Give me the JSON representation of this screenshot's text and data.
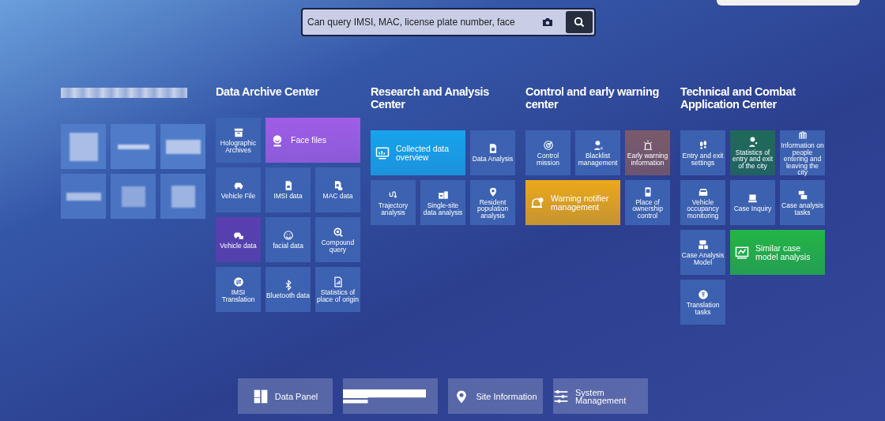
{
  "search": {
    "placeholder": "Can query IMSI, MAC, license plate number, face"
  },
  "sections": [
    {
      "title": "Data Archive Center",
      "tiles": [
        {
          "label": "Holographic Archives",
          "wide": false
        },
        {
          "label": "Face files",
          "wide": true,
          "color": "#a05de6"
        },
        {
          "label": "Vehicle File",
          "wide": false
        },
        {
          "label": "IMSI data",
          "wide": false
        },
        {
          "label": "MAC data",
          "wide": false
        },
        {
          "label": "Vehicle data",
          "wide": false,
          "color": "#5a3fb0"
        },
        {
          "label": "facial data",
          "wide": false
        },
        {
          "label": "Compound query",
          "wide": false
        },
        {
          "label": "IMSI Translation",
          "wide": false
        },
        {
          "label": "Bluetooth data",
          "wide": false
        },
        {
          "label": "Statistics of place of origin",
          "wide": false
        }
      ]
    },
    {
      "title": "Research and Analysis Center",
      "tiles": [
        {
          "label": "Collected data overview",
          "wide": true,
          "color": "#17a3ec"
        },
        {
          "label": "Data Analysis",
          "wide": false
        },
        {
          "label": "Trajectory analysis",
          "wide": false
        },
        {
          "label": "Single-site data analysis",
          "wide": false
        },
        {
          "label": "Resident population analysis",
          "wide": false
        }
      ]
    },
    {
      "title": "Control and early warning center",
      "tiles": [
        {
          "label": "Control mission",
          "wide": false
        },
        {
          "label": "Blacklist management",
          "wide": false
        },
        {
          "label": "Early warning information",
          "wide": false,
          "color": "#7a5a6a"
        },
        {
          "label": "Warning notifier management",
          "wide": true,
          "color": "#eba81a"
        },
        {
          "label": "Place of ownership control",
          "wide": false
        }
      ]
    },
    {
      "title": "Technical and Combat Application Center",
      "tiles": [
        {
          "label": "Entry and exit settings",
          "wide": false
        },
        {
          "label": "Statistics of entry and exit of the city",
          "wide": false,
          "color": "#1f6a5a"
        },
        {
          "label": "Information on people entering and leaving the city",
          "wide": false
        },
        {
          "label": "Vehicle occupancy monitoring",
          "wide": false
        },
        {
          "label": "Case Inquiry",
          "wide": false
        },
        {
          "label": "Case analysis tasks",
          "wide": false
        },
        {
          "label": "Case Analysis Model",
          "wide": false
        },
        {
          "label": "Similar case model analysis",
          "wide": true,
          "color": "#22b545"
        },
        {
          "label": "Translation tasks",
          "wide": false
        }
      ]
    }
  ],
  "bottom_nav": [
    {
      "label": "Data Panel"
    },
    {
      "label": "Site Information"
    },
    {
      "label": "System Management"
    }
  ]
}
